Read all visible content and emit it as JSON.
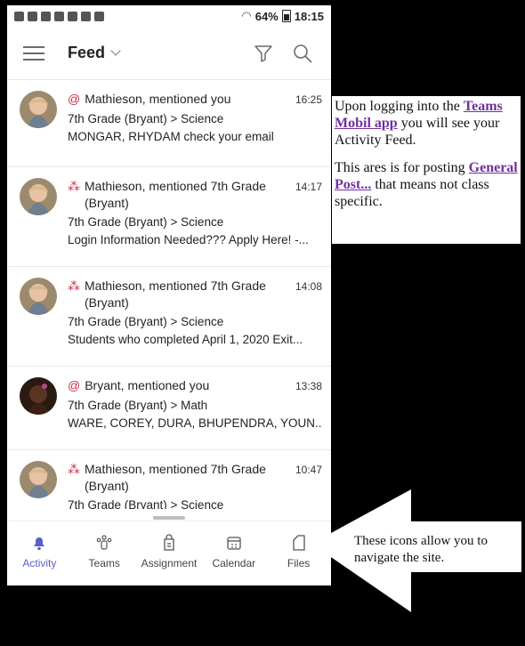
{
  "status": {
    "battery": "64%",
    "time": "18:15"
  },
  "header": {
    "title": "Feed"
  },
  "feed": [
    {
      "kind": "@",
      "head": "Mathieson, mentioned you",
      "time": "16:25",
      "channel": "7th Grade (Bryant)  > Science",
      "preview": "MONGAR, RHYDAM check your email"
    },
    {
      "kind": "team",
      "head": "Mathieson, mentioned 7th Grade (Bryant)",
      "time": "14:17",
      "channel": "7th Grade (Bryant)  > Science",
      "preview": "Login Information Needed??? Apply Here! -..."
    },
    {
      "kind": "team",
      "head": "Mathieson, mentioned 7th Grade (Bryant)",
      "time": "14:08",
      "channel": "7th Grade (Bryant)  > Science",
      "preview": "Students who completed April 1, 2020 Exit..."
    },
    {
      "kind": "@",
      "head": "Bryant, mentioned you",
      "time": "13:38",
      "channel": "7th Grade (Bryant)  > Math",
      "preview": "WARE, COREY, DURA, BHUPENDRA, YOUN..."
    },
    {
      "kind": "team",
      "head": "Mathieson, mentioned 7th Grade (Bryant)",
      "time": "10:47",
      "channel": "7th Grade (Bryant)  > Science",
      "preview": ""
    }
  ],
  "tabs": [
    "Activity",
    "Teams",
    "Assignment",
    "Calendar",
    "Files"
  ],
  "note": {
    "p1a": "Upon logging into the ",
    "p1link": "Teams Mobil app",
    "p1b": " you will see your Activity Feed.",
    "p2a": "This ares is for posting ",
    "p2link": "General Post...",
    "p2b": " that means not class specific."
  },
  "arrow_note": "These icons allow you to navigate the site.",
  "colors": {
    "accent": "#5b5fc7",
    "mention": "#c4314b",
    "link": "#7030a0"
  }
}
